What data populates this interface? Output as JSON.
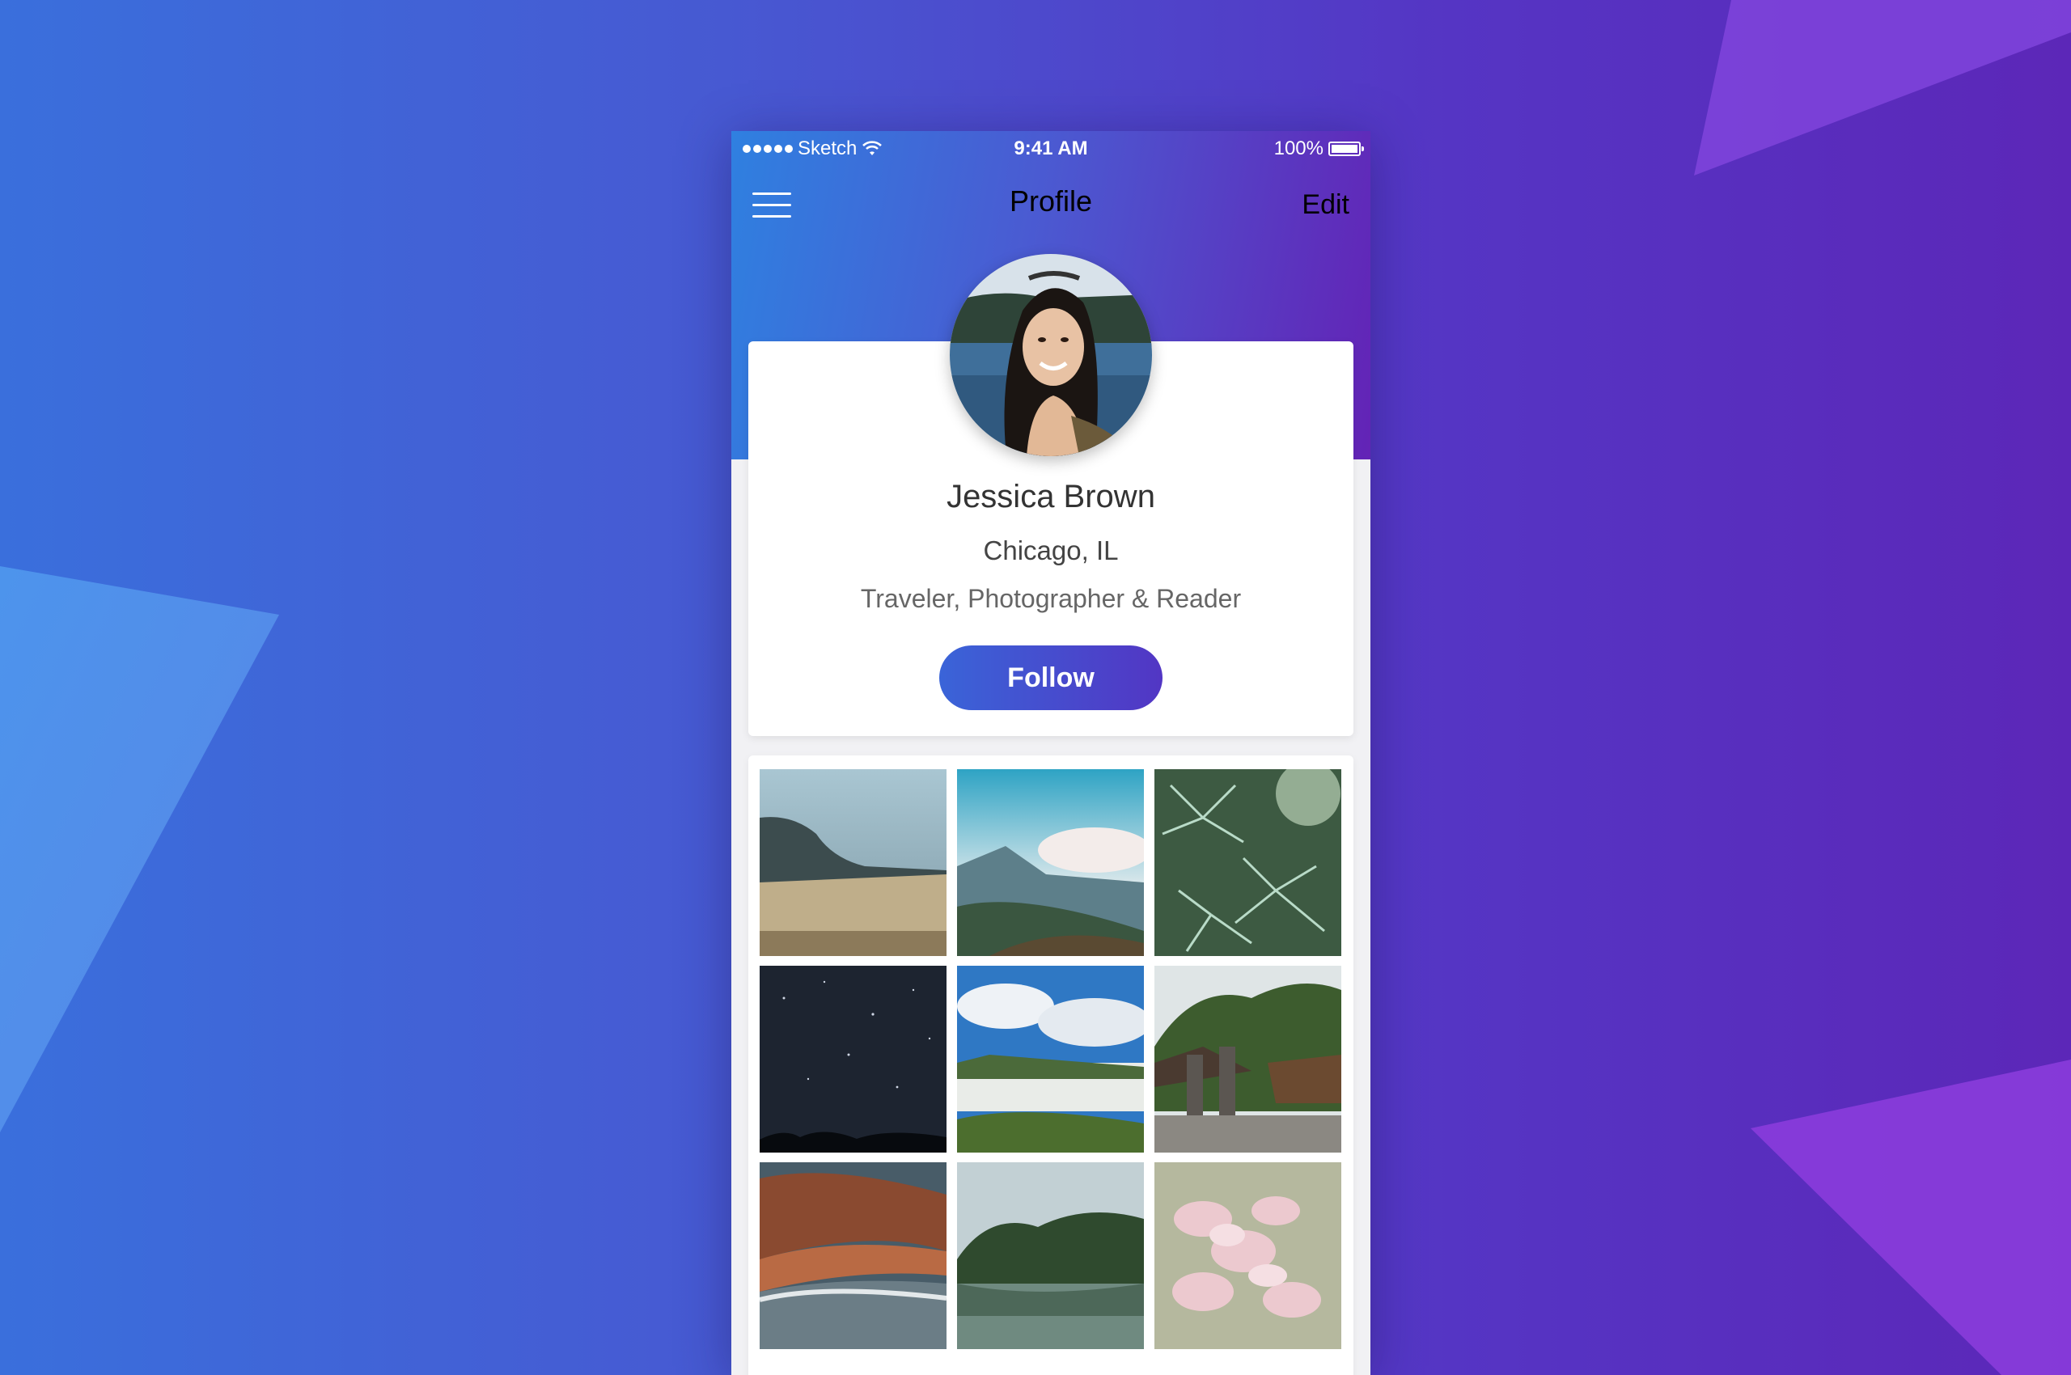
{
  "status_bar": {
    "carrier": "Sketch",
    "time": "9:41 AM",
    "battery": "100%"
  },
  "nav": {
    "title": "Profile",
    "edit_label": "Edit"
  },
  "profile": {
    "name": "Jessica Brown",
    "location": "Chicago, IL",
    "bio": "Traveler, Photographer & Reader",
    "follow_label": "Follow"
  },
  "photos": [
    {
      "icon": "foggy-coast-photo"
    },
    {
      "icon": "mountain-valley-photo"
    },
    {
      "icon": "pine-branches-photo"
    },
    {
      "icon": "starry-night-photo"
    },
    {
      "icon": "waterfall-photo"
    },
    {
      "icon": "temple-photo"
    },
    {
      "icon": "rocky-shore-photo"
    },
    {
      "icon": "forest-lake-photo"
    },
    {
      "icon": "pink-flowers-photo"
    }
  ],
  "colors": {
    "header_start": "#2f80e0",
    "header_end": "#6323b6",
    "button_start": "#3a64d8",
    "button_end": "#5236c4"
  }
}
